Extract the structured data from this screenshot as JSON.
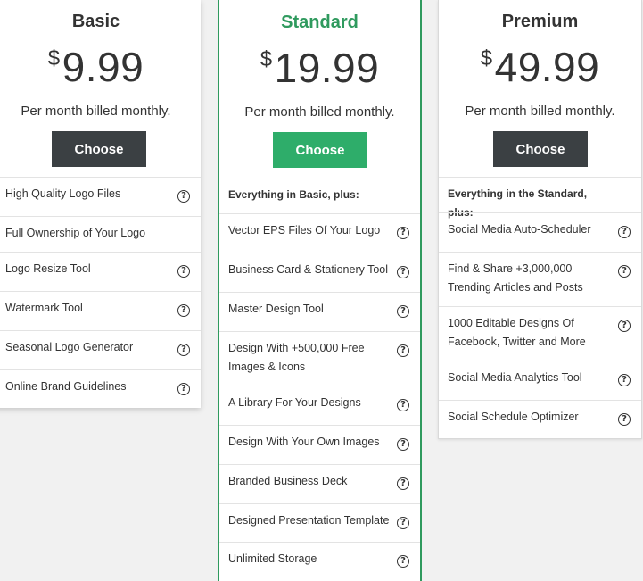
{
  "plans": {
    "basic": {
      "name": "Basic",
      "currency": "$",
      "price": "9.99",
      "billing": "Per month billed monthly.",
      "cta": "Choose",
      "features": [
        "High Quality Logo Files",
        "Full Ownership of Your Logo",
        "Logo Resize Tool",
        "Watermark Tool",
        "Seasonal Logo Generator",
        "Online Brand Guidelines"
      ]
    },
    "standard": {
      "name": "Standard",
      "currency": "$",
      "price": "19.99",
      "billing": "Per month billed monthly.",
      "cta": "Choose",
      "features_header": "Everything in Basic, plus:",
      "features": [
        "Vector EPS Files Of Your Logo",
        "Business Card & Stationery Tool",
        "Master Design Tool",
        "Design With +500,000 Free Images & Icons",
        "A Library For Your Designs",
        "Design With Your Own Images",
        "Branded Business Deck",
        "Designed Presentation Template",
        "Unlimited Storage"
      ]
    },
    "premium": {
      "name": "Premium",
      "currency": "$",
      "price": "49.99",
      "billing": "Per month billed monthly.",
      "cta": "Choose",
      "features_header": "Everything in the Standard, plus:",
      "features": [
        "Social Media Auto-Scheduler",
        "Find & Share +3,000,000 Trending Articles and Posts",
        "1000 Editable Designs Of Facebook, Twitter and More",
        "Social Media Analytics Tool",
        "Social Schedule Optimizer"
      ]
    }
  },
  "help_glyph": "?",
  "colors": {
    "accent_green": "#2ead6a",
    "standard_border": "#2f9a5e",
    "button_dark": "#3b4043"
  }
}
